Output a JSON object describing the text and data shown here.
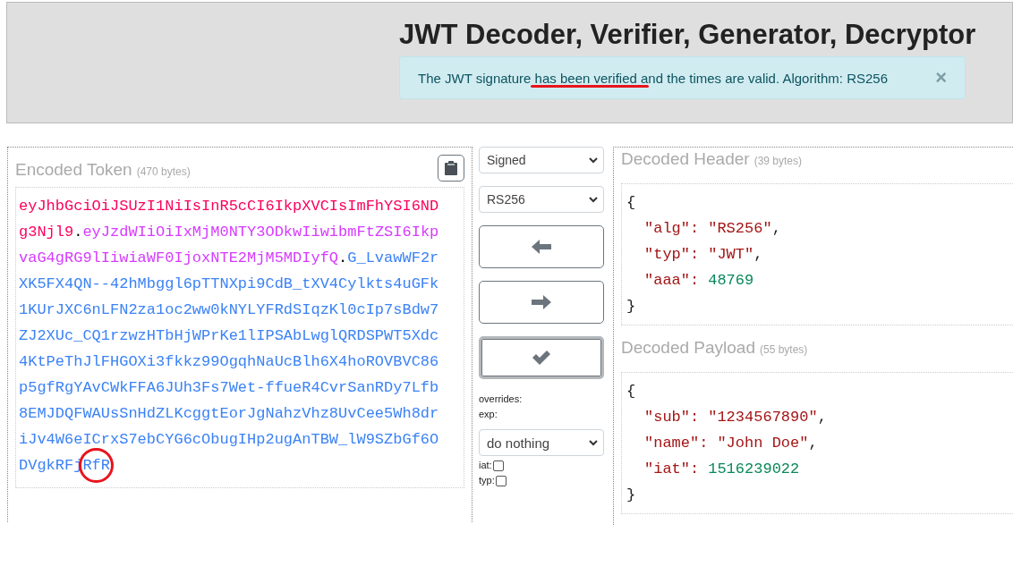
{
  "title": "JWT Decoder, Verifier, Generator, Decryptor",
  "alert": {
    "text": "The JWT signature has been verified and the times are valid. Algorithm: RS256",
    "close": "×"
  },
  "encoded": {
    "title": "Encoded Token",
    "bytes": "(470 bytes)",
    "token_lines": [
      [
        {
          "kind": "header",
          "text": "eyJhbGciOiJSUzI1NiIsInR5cCI6IkpXVCIsImFhYSI6ND",
          "circled": false
        }
      ],
      [
        {
          "kind": "header",
          "text": "g3Njl9",
          "circled": false
        },
        {
          "kind": "separator",
          "text": ".",
          "circled": false
        },
        {
          "kind": "payload",
          "text": "eyJzdWIiOiIxMjM0NTY3ODkwIiwibmFtZSI6Ikp",
          "circled": false
        }
      ],
      [
        {
          "kind": "payload",
          "text": "vaG4gRG9lIiwiaWF0IjoxNTE2MjM5MDIyfQ",
          "circled": false
        },
        {
          "kind": "separator",
          "text": ".",
          "circled": false
        },
        {
          "kind": "signature",
          "text": "G_LvawWF2r",
          "circled": false
        }
      ],
      [
        {
          "kind": "signature",
          "text": "XK5FX4QN--42hMbggl6pTTNXpi9CdB_tXV4Cylkts4uGFk",
          "circled": false
        }
      ],
      [
        {
          "kind": "signature",
          "text": "1KUrJXC6nLFN2za1oc2ww0kNYLYFRdSIqzKl0cIp7sBdw7",
          "circled": false
        }
      ],
      [
        {
          "kind": "signature",
          "text": "ZJ2XUc_CQ1rzwzHTbHjWPrKe1lIPSAbLwglQRDSPWT5Xdc",
          "circled": false
        }
      ],
      [
        {
          "kind": "signature",
          "text": "4KtPeThJlFHGOXi3fkkz99OgqhNaUcBlh6X4hoROVBVC86",
          "circled": false
        }
      ],
      [
        {
          "kind": "signature",
          "text": "p5gfRgYAvCWkFFA6JUh3Fs7Wet-ffueR4CvrSanRDy7Lfb",
          "circled": false
        }
      ],
      [
        {
          "kind": "signature",
          "text": "8EMJDQFWAUsSnHdZLKcggtEorJgNahzVhz8UvCee5Wh8dr",
          "circled": false
        }
      ],
      [
        {
          "kind": "signature",
          "text": "iJv4W6eICrxS7ebCYG6cObugIHp2ugAnTBW_lW9SZbGf6O",
          "circled": false
        }
      ],
      [
        {
          "kind": "signature",
          "text": "DVgkRFj",
          "circled": false
        },
        {
          "kind": "signature",
          "text": "RfR",
          "circled": true
        }
      ]
    ]
  },
  "controls": {
    "mode": "Signed",
    "algorithm": "RS256",
    "buttons": [
      {
        "kind": "left",
        "selected": false
      },
      {
        "kind": "right",
        "selected": false
      },
      {
        "kind": "check",
        "selected": true
      }
    ],
    "overrides_label": "overrides:",
    "exp_label": "exp:",
    "exp_select": "do nothing",
    "checks": [
      {
        "label": "iat:",
        "checked": false
      },
      {
        "label": "typ:",
        "checked": false
      }
    ]
  },
  "header": {
    "title": "Decoded Header",
    "bytes": "(39 bytes)",
    "open": "{",
    "close": "}",
    "entries": [
      {
        "key": "\"alg\":",
        "value": "\"RS256\"",
        "kind": "string",
        "comma": ","
      },
      {
        "key": "\"typ\":",
        "value": "\"JWT\"",
        "kind": "string",
        "comma": ","
      },
      {
        "key": "\"aaa\":",
        "value": "48769",
        "kind": "number"
      }
    ]
  },
  "payload": {
    "title": "Decoded Payload",
    "bytes": "(55 bytes)",
    "open": "{",
    "close": "}",
    "entries": [
      {
        "key": "\"sub\":",
        "value": "\"1234567890\"",
        "kind": "string",
        "comma": ","
      },
      {
        "key": "\"name\":",
        "value": "\"John Doe\"",
        "kind": "string",
        "comma": ","
      },
      {
        "key": "\"iat\":",
        "value": "1516239022",
        "kind": "number"
      }
    ]
  }
}
